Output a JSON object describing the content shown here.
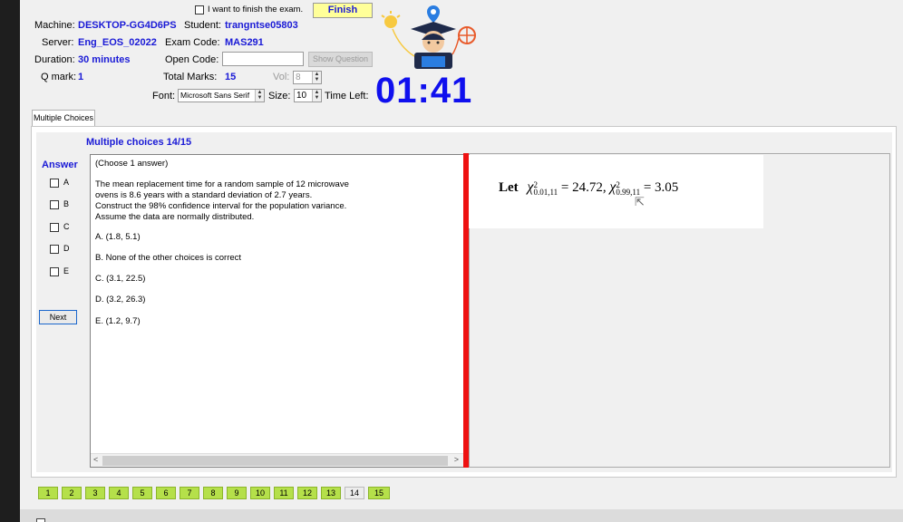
{
  "header": {
    "finish_checkbox_label": "I want to finish the exam.",
    "finish_button": "Finish",
    "machine_label": "Machine:",
    "machine_value": "DESKTOP-GG4D6PS",
    "student_label": "Student:",
    "student_value": "trangntse05803",
    "server_label": "Server:",
    "server_value": "Eng_EOS_02022",
    "exam_code_label": "Exam Code:",
    "exam_code_value": "MAS291",
    "duration_label": "Duration:",
    "duration_value": "30 minutes",
    "open_code_label": "Open Code:",
    "open_code_value": "",
    "show_question_button": "Show Question",
    "q_mark_label": "Q mark:",
    "q_mark_value": "1",
    "total_marks_label": "Total Marks:",
    "total_marks_value": "15",
    "vol_label": "Vol:",
    "vol_value": "8",
    "font_label": "Font:",
    "font_value": "Microsoft Sans Serif",
    "size_label": "Size:",
    "size_value": "10",
    "time_left_label": "Time Left:",
    "timer": "01:41"
  },
  "tab_label": "Multiple Choices",
  "question": {
    "title": "Multiple choices 14/15",
    "answer_label": "Answer",
    "answer_options": [
      "A",
      "B",
      "C",
      "D",
      "E"
    ],
    "next_button": "Next",
    "instruction": "(Choose 1 answer)",
    "text_lines": [
      "The mean replacement time for a random sample of 12 microwave",
      "ovens is 8.6 years with a standard deviation of 2.7 years.",
      "Construct the 98% confidence interval for the population variance.",
      "Assume the data are normally distributed."
    ],
    "choices": [
      "A. (1.8, 5.1)",
      "B. None of the other choices is correct",
      "C. (3.1, 22.5)",
      "D. (3.2, 26.3)",
      "E. (1.2, 9.7)"
    ]
  },
  "formula": {
    "let": "Let",
    "chi1_sup": "2",
    "chi1_sub": "0.01,11",
    "chi1_value": "= 24.72,",
    "chi2_sup": "2",
    "chi2_sub": "0.99,11",
    "chi2_value": "= 3.05"
  },
  "question_nav": [
    "1",
    "2",
    "3",
    "4",
    "5",
    "6",
    "7",
    "8",
    "9",
    "10",
    "11",
    "12",
    "13",
    "14",
    "15"
  ],
  "colors": {
    "accent_blue": "#1a1ad6",
    "timer_blue": "#1010ee",
    "finish_yellow": "#ffff99",
    "nav_green": "#b5e04a",
    "divider_red": "#ee1111"
  }
}
